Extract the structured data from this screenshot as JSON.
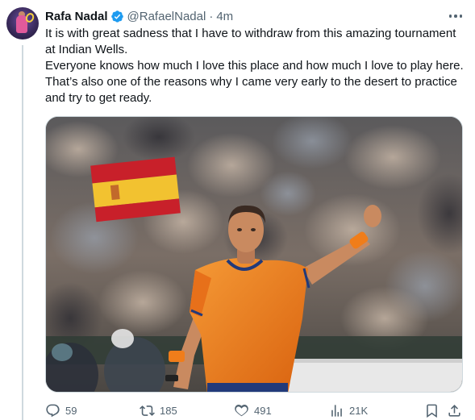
{
  "author": {
    "name": "Rafa Nadal",
    "handle": "@RafaelNadal",
    "separator": "·",
    "time": "4m",
    "verified": true
  },
  "post": {
    "paragraph_1": "It is with great sadness that I have to withdraw from this amazing tournament at Indian Wells.",
    "paragraph_2": "Everyone knows how much I love this place and how much I love to play here. That’s also one of the reasons why I came very early to the desert to practice and try to get ready."
  },
  "media": {
    "icon": "photo-tennis-player-icon"
  },
  "actions": {
    "reply_count": "59",
    "repost_count": "185",
    "like_count": "491",
    "view_count": "21K"
  },
  "colors": {
    "verified_badge": "#1d9bf0",
    "secondary_text": "#536471",
    "primary_text": "#0f1419",
    "player_shirt": "#f07d1a"
  }
}
